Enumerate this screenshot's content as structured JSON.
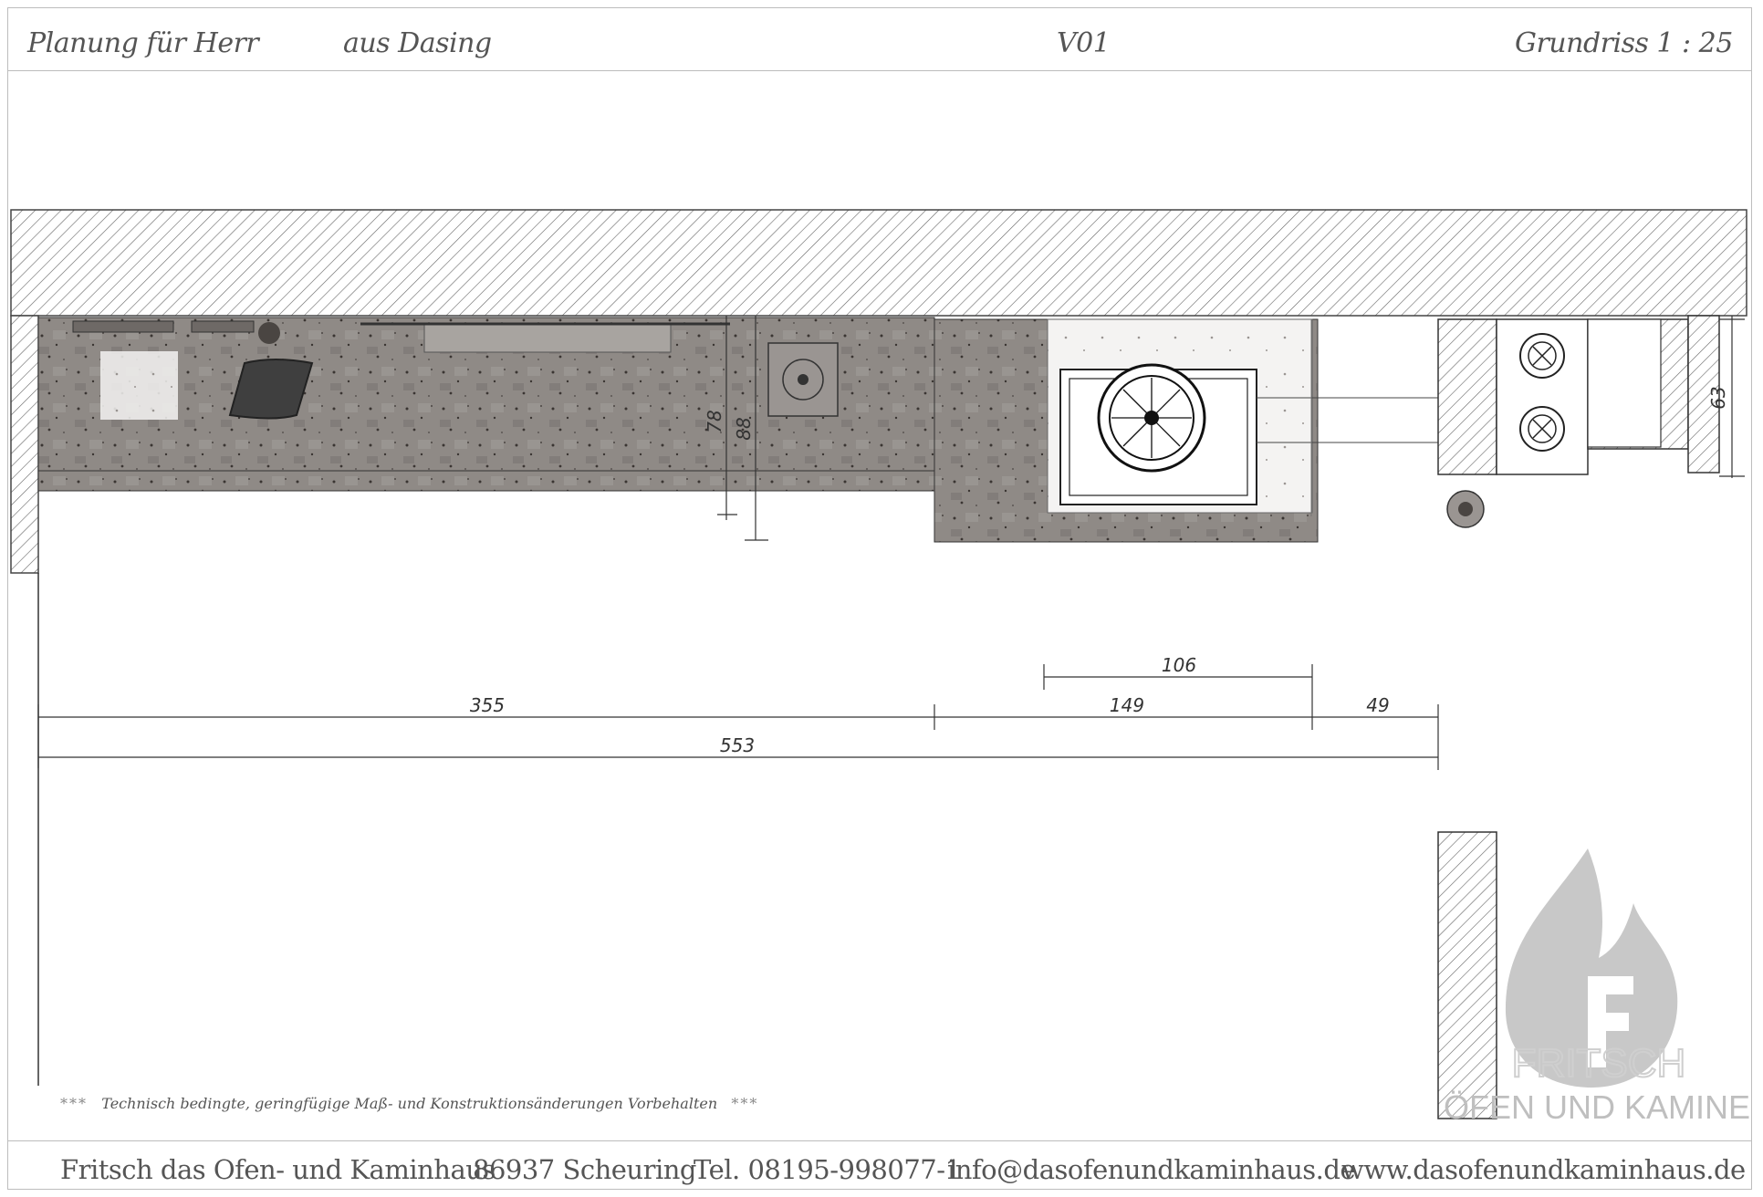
{
  "header": {
    "planning_for": "Planung für Herr",
    "location": "aus Dasing",
    "version": "V01",
    "plan_type": "Grundriss 1 : 25"
  },
  "dimensions": {
    "d355": "355",
    "d553": "553",
    "d106": "106",
    "d149": "149",
    "d49": "49",
    "d63": "63",
    "d78": "78",
    "d88": "88"
  },
  "logo": {
    "line1": "FRITSCH",
    "line2": "ÖFEN UND KAMINE",
    "icon": "flame-logo-icon"
  },
  "disclaimer": {
    "stars_left": "***",
    "text": "Technisch bedingte, geringfügige Maß- und Konstruktionsänderungen Vorbehalten",
    "stars_right": "***"
  },
  "footer": {
    "company": "Fritsch das Ofen- und Kaminhaus",
    "address": "86937 Scheuring",
    "phone": "Tel. 08195-998077-1",
    "email": "info@dasofenundkaminhaus.de",
    "website": "www.dasofenundkaminhaus.de"
  },
  "colors": {
    "hatch": "#555555",
    "stone": "#8f8a86",
    "stone_dark": "#6e6966",
    "line": "#333333"
  }
}
